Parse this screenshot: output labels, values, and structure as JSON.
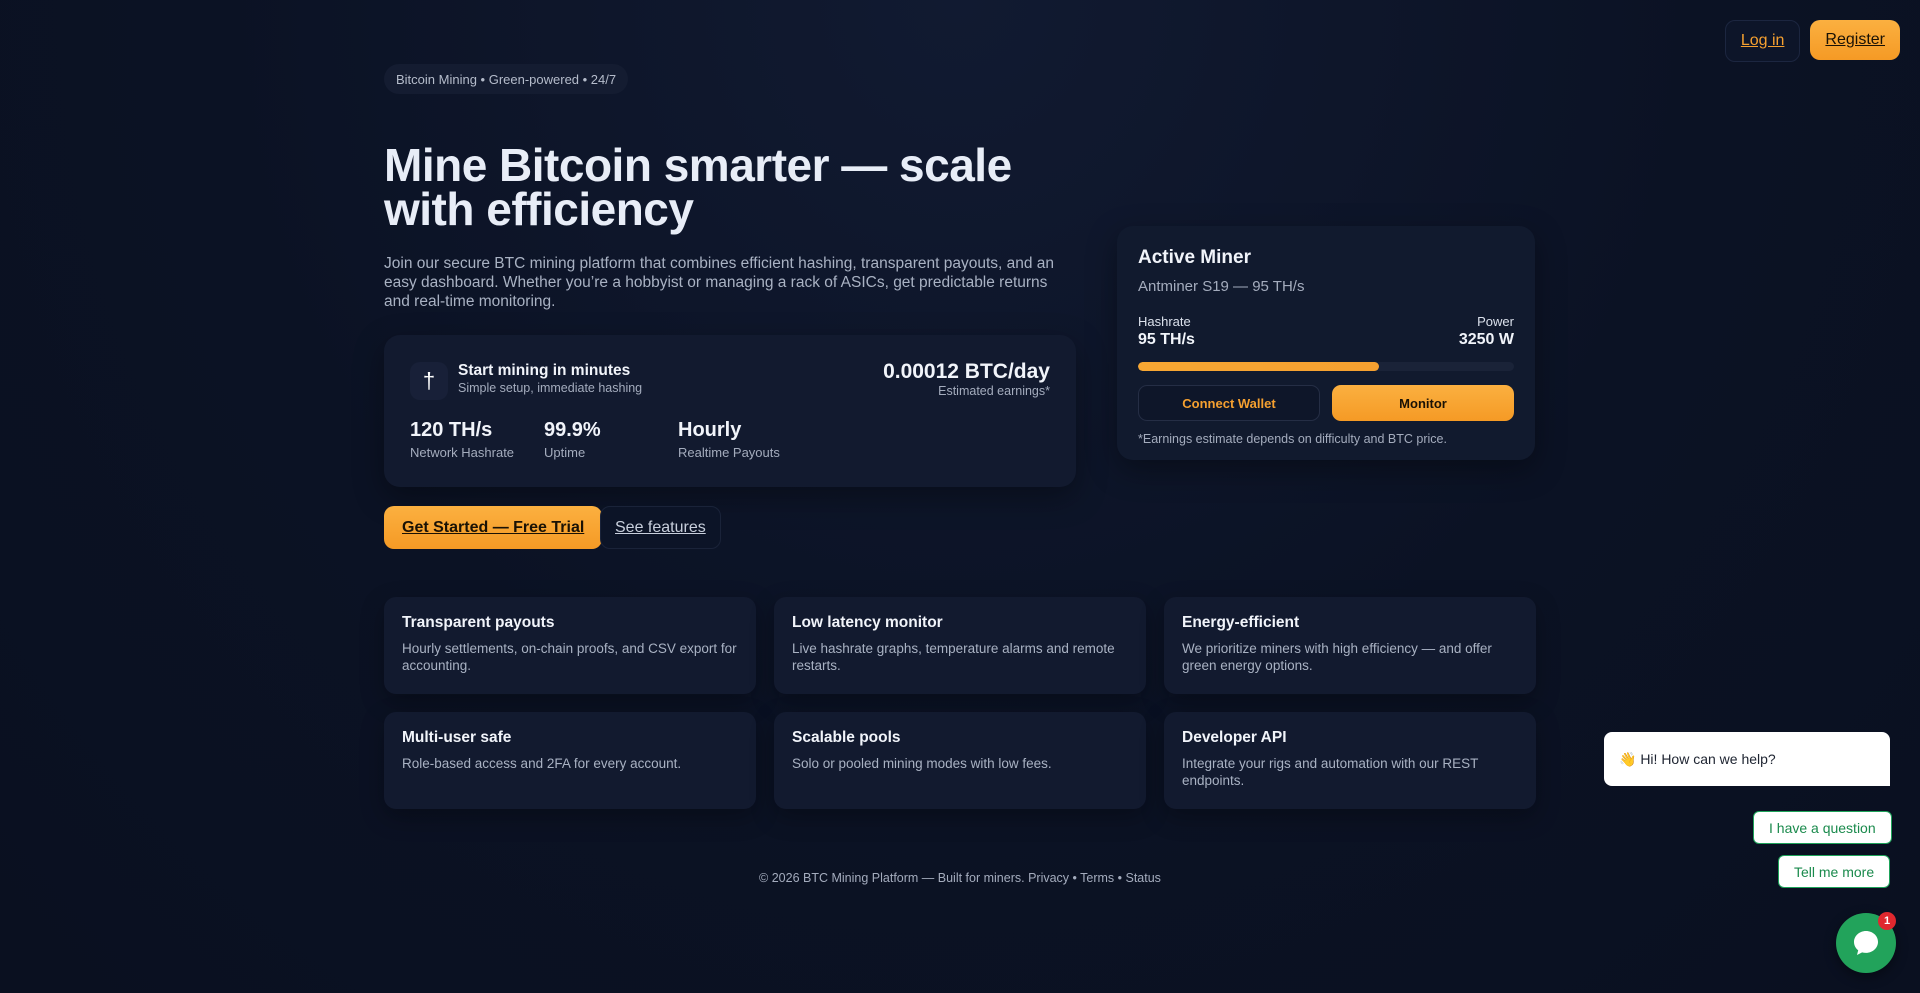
{
  "nav": {
    "login_label": "Log in",
    "register_label": "Register"
  },
  "hero": {
    "pill": "Bitcoin Mining • Green-powered • 24/7",
    "title": "Mine Bitcoin smarter — scale with efficiency",
    "description": "Join our secure BTC mining platform that combines efficient hashing, transparent payouts, and an easy dashboard. Whether you’re a hobbyist or managing a rack of ASICs, get predictable returns and real-time monitoring."
  },
  "stats_card": {
    "icon_glyph": "†",
    "title": "Start mining in minutes",
    "subtitle": "Simple setup, immediate hashing",
    "earnings_value": "0.00012 BTC/day",
    "earnings_label": "Estimated earnings*",
    "stats": [
      {
        "value": "120 TH/s",
        "label": "Network Hashrate"
      },
      {
        "value": "99.9%",
        "label": "Uptime"
      },
      {
        "value": "Hourly",
        "label": "Realtime Payouts"
      }
    ]
  },
  "cta": {
    "primary_label": "Get Started — Free Trial",
    "secondary_label": "See features"
  },
  "miner": {
    "title": "Active Miner",
    "model": "Antminer S19 — 95 TH/s",
    "hashrate_label": "Hashrate",
    "hashrate_value": "95 TH/s",
    "power_label": "Power",
    "power_value": "3250 W",
    "progress_fraction": 0.64,
    "connect_label": "Connect Wallet",
    "monitor_label": "Monitor",
    "note": "*Earnings estimate depends on difficulty and BTC price."
  },
  "features": [
    {
      "title": "Transparent payouts",
      "description": "Hourly settlements, on-chain proofs, and CSV export for accounting."
    },
    {
      "title": "Low latency monitor",
      "description": "Live hashrate graphs, temperature alarms and remote restarts."
    },
    {
      "title": "Energy-efficient",
      "description": "We prioritize miners with high efficiency — and offer green energy options."
    },
    {
      "title": "Multi-user safe",
      "description": "Role-based access and 2FA for every account."
    },
    {
      "title": "Scalable pools",
      "description": "Solo or pooled mining modes with low fees."
    },
    {
      "title": "Developer API",
      "description": "Integrate your rigs and automation with our REST endpoints."
    }
  ],
  "footer": {
    "text": "© 2026 BTC Mining Platform — Built for miners. Privacy • Terms • Status"
  },
  "chat": {
    "greeting": "👋 Hi! How can we help?",
    "option_1": "I have a question",
    "option_2": "Tell me more",
    "badge_count": "1"
  },
  "colors": {
    "accent": "#f5a030",
    "background": "#0b1224",
    "card": "#121a2f",
    "chat_green": "#22a35b"
  }
}
